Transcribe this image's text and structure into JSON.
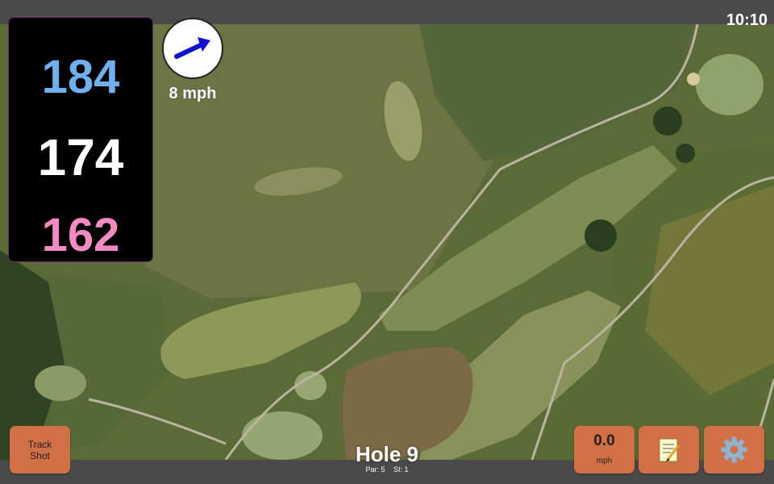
{
  "status_bar": {
    "time": "10:10"
  },
  "yardages": {
    "back": "184",
    "middle": "174",
    "front": "162"
  },
  "wind": {
    "speed_label": "8 mph",
    "direction_icon": "arrow-icon"
  },
  "track_shot": {
    "line1": "Track",
    "line2": "Shot"
  },
  "hole": {
    "title": "Hole 9",
    "par": "Par: 5",
    "stroke_index": "SI: 1"
  },
  "speed_button": {
    "value": "0.0",
    "unit": "mph"
  },
  "icons": {
    "notes": "notes-icon",
    "settings": "gear-icon"
  },
  "colors": {
    "back_yardage": "#6fb0ef",
    "middle_yardage": "#ffffff",
    "front_yardage": "#f58ac3",
    "button": "#d07044",
    "wind_arrow": "#1010d0"
  }
}
